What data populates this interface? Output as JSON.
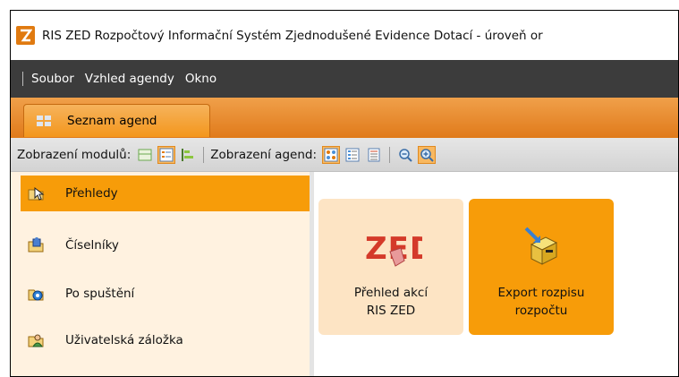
{
  "window": {
    "title": "RIS ZED Rozpočtový Informační Systém Zjednodušené Evidence Dotací - úroveň or"
  },
  "menu": {
    "items": [
      "Soubor",
      "Vzhled agendy",
      "Okno"
    ]
  },
  "tabs": [
    {
      "label": "Seznam agend",
      "icon": "grid-icon"
    }
  ],
  "toolbar": {
    "modules_label": "Zobrazení modulů:",
    "agendas_label": "Zobrazení agend:",
    "module_buttons": [
      "single-view-icon",
      "list-view-icon",
      "bar-view-icon"
    ],
    "agenda_buttons": [
      "large-icons-icon",
      "detail-list-icon",
      "small-list-icon"
    ],
    "zoom_buttons": [
      "zoom-out-icon",
      "zoom-in-icon"
    ],
    "active_module_view": "list-view-icon",
    "active_agenda_view": "large-icons-icon",
    "active_zoom": "zoom-in-icon"
  },
  "sidebar": {
    "items": [
      {
        "label": "Přehledy",
        "icon": "cursor-folder-icon",
        "active": true
      },
      {
        "label": "Číselníky",
        "icon": "folder-puzzle-icon",
        "active": false
      },
      {
        "label": "Po spuštění",
        "icon": "folder-gear-icon",
        "active": false
      },
      {
        "label": "Uživatelská záložka",
        "icon": "folder-user-icon",
        "active": false
      }
    ]
  },
  "tiles": [
    {
      "label_line1": "Přehled akcí",
      "label_line2": "RIS ZED",
      "icon": "zed-logo-icon",
      "logo_text": "ZED"
    },
    {
      "label_line1": "Export rozpisu",
      "label_line2": "rozpočtu",
      "icon": "export-cabinet-icon"
    }
  ],
  "colors": {
    "accent": "#f79c09",
    "tile_light": "#fde4c4",
    "menubar": "#3c3c3c",
    "sidebar_bg": "#fff2e0"
  }
}
